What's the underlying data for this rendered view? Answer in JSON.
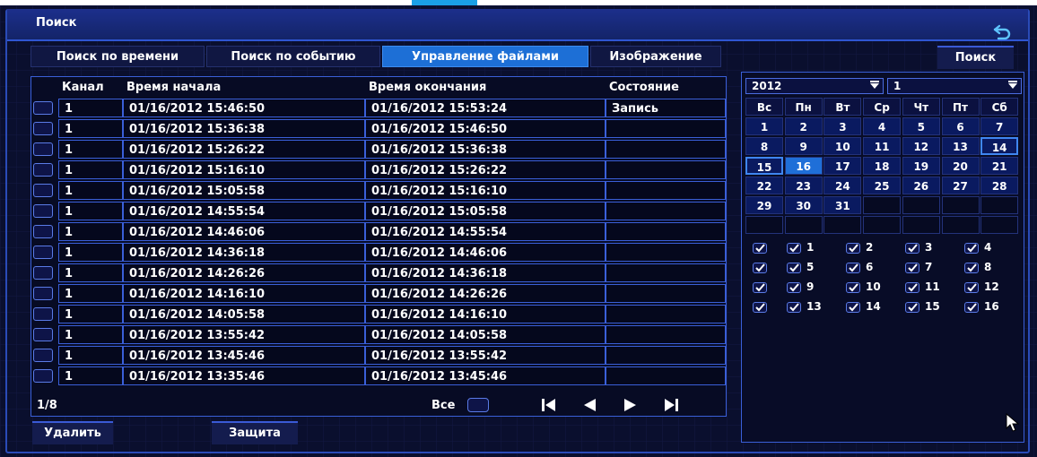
{
  "window": {
    "title": "Поиск"
  },
  "tabs": [
    {
      "label": "Поиск по времени",
      "active": false
    },
    {
      "label": "Поиск по событию",
      "active": false
    },
    {
      "label": "Управление файлами",
      "active": true
    },
    {
      "label": "Изображение",
      "active": false
    }
  ],
  "search_button": "Поиск",
  "table": {
    "headers": {
      "channel": "Канал",
      "start": "Время начала",
      "end": "Время окончания",
      "state": "Состояние"
    },
    "rows": [
      {
        "channel": "1",
        "start": "01/16/2012 15:46:50",
        "end": "01/16/2012 15:53:24",
        "state": "Запись"
      },
      {
        "channel": "1",
        "start": "01/16/2012 15:36:38",
        "end": "01/16/2012 15:46:50",
        "state": ""
      },
      {
        "channel": "1",
        "start": "01/16/2012 15:26:22",
        "end": "01/16/2012 15:36:38",
        "state": ""
      },
      {
        "channel": "1",
        "start": "01/16/2012 15:16:10",
        "end": "01/16/2012 15:26:22",
        "state": ""
      },
      {
        "channel": "1",
        "start": "01/16/2012 15:05:58",
        "end": "01/16/2012 15:16:10",
        "state": ""
      },
      {
        "channel": "1",
        "start": "01/16/2012 14:55:54",
        "end": "01/16/2012 15:05:58",
        "state": ""
      },
      {
        "channel": "1",
        "start": "01/16/2012 14:46:06",
        "end": "01/16/2012 14:55:54",
        "state": ""
      },
      {
        "channel": "1",
        "start": "01/16/2012 14:36:18",
        "end": "01/16/2012 14:46:06",
        "state": ""
      },
      {
        "channel": "1",
        "start": "01/16/2012 14:26:26",
        "end": "01/16/2012 14:36:18",
        "state": ""
      },
      {
        "channel": "1",
        "start": "01/16/2012 14:16:10",
        "end": "01/16/2012 14:26:26",
        "state": ""
      },
      {
        "channel": "1",
        "start": "01/16/2012 14:05:58",
        "end": "01/16/2012 14:16:10",
        "state": ""
      },
      {
        "channel": "1",
        "start": "01/16/2012 13:55:42",
        "end": "01/16/2012 14:05:58",
        "state": ""
      },
      {
        "channel": "1",
        "start": "01/16/2012 13:45:46",
        "end": "01/16/2012 13:55:42",
        "state": ""
      },
      {
        "channel": "1",
        "start": "01/16/2012 13:35:46",
        "end": "01/16/2012 13:45:46",
        "state": ""
      }
    ],
    "page": "1/8",
    "select_all_label": "Все"
  },
  "actions": {
    "delete": "Удалить",
    "protect": "Защита"
  },
  "calendar": {
    "year": "2012",
    "month": "1",
    "weekdays": [
      "Вс",
      "Пн",
      "Вт",
      "Ср",
      "Чт",
      "Пт",
      "Сб"
    ],
    "weeks": [
      [
        "1",
        "2",
        "3",
        "4",
        "5",
        "6",
        "7"
      ],
      [
        "8",
        "9",
        "10",
        "11",
        "12",
        "13",
        "14"
      ],
      [
        "15",
        "16",
        "17",
        "18",
        "19",
        "20",
        "21"
      ],
      [
        "22",
        "23",
        "24",
        "25",
        "26",
        "27",
        "28"
      ],
      [
        "29",
        "30",
        "31",
        "",
        "",
        "",
        ""
      ],
      [
        "",
        "",
        "",
        "",
        "",
        "",
        ""
      ]
    ],
    "selected_day": "16",
    "outlined_days": [
      "14",
      "15"
    ]
  },
  "channels": {
    "rows": [
      [
        "1",
        "2",
        "3",
        "4"
      ],
      [
        "5",
        "6",
        "7",
        "8"
      ],
      [
        "9",
        "10",
        "11",
        "12"
      ],
      [
        "13",
        "14",
        "15",
        "16"
      ]
    ]
  },
  "colors": {
    "accent": "#1d6fd6",
    "border": "#3a5fd8",
    "background": "#0a0f2e"
  },
  "icons": {
    "back": "back-arrow-icon",
    "first": "first-page-icon",
    "prev": "prev-page-icon",
    "next": "next-page-icon",
    "last": "last-page-icon",
    "check": "check-icon"
  }
}
